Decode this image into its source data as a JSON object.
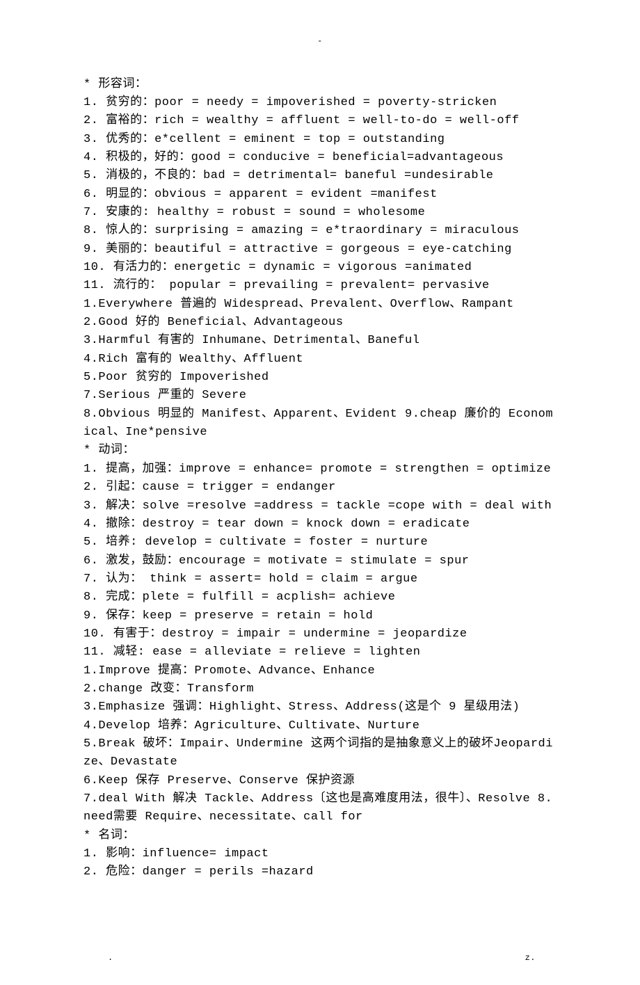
{
  "topMark": "-",
  "footerLeft": ".",
  "footerRight": "z.",
  "lines": [
    "* 形容词：",
    "1. 贫穷的：poor = needy = impoverished = poverty-stricken",
    "2. 富裕的：rich = wealthy = affluent = well-to-do = well-off",
    "3. 优秀的：e*cellent = eminent = top = outstanding",
    "4. 积极的，好的：good = conducive = beneficial=advantageous",
    "5. 消极的，不良的：bad = detrimental= baneful =undesirable",
    "6. 明显的：obvious = apparent = evident =manifest",
    "7. 安康的: healthy = robust = sound = wholesome",
    "8. 惊人的：surprising = amazing = e*traordinary = miraculous",
    "9. 美丽的：beautiful = attractive = gorgeous = eye-catching",
    "10. 有活力的：energetic = dynamic = vigorous =animated",
    "11. 流行的： popular = prevailing = prevalent= pervasive",
    "1.Everywhere 普遍的 Widespread、Prevalent、Overflow、Rampant",
    "2.Good 好的 Beneficial、Advantageous",
    "3.Harmful 有害的 Inhumane、Detrimental、Baneful",
    "4.Rich 富有的 Wealthy、Affluent",
    "5.Poor 贫穷的 Impoverished",
    "7.Serious 严重的 Severe",
    "8.Obvious 明显的 Manifest、Apparent、Evident 9.cheap 廉价的 Economical、Ine*pensive",
    "* 动词：",
    "1. 提高，加强：improve = enhance= promote = strengthen = optimize",
    "2. 引起：cause = trigger = endanger",
    "3. 解决：solve =resolve =address = tackle =cope with = deal with",
    "4. 撤除：destroy = tear down = knock down = eradicate",
    "5. 培养: develop = cultivate = foster = nurture",
    "6. 激发，鼓励：encourage = motivate = stimulate = spur",
    "7. 认为： think = assert= hold = claim = argue",
    "8. 完成：plete = fulfill = acplish= achieve",
    "9. 保存：keep = preserve = retain = hold",
    "10. 有害于：destroy = impair = undermine = jeopardize",
    "11. 减轻: ease = alleviate = relieve = lighten",
    "1.Improve 提高：Promote、Advance、Enhance",
    "2.change 改变：Transform",
    "3.Emphasize 强调：Highlight、Stress、Address(这是个 9 星级用法)",
    "4.Develop 培养：Agriculture、Cultivate、Nurture",
    "5.Break 破坏：Impair、Undermine 这两个词指的是抽象意义上的破坏Jeopardize、Devastate",
    "6.Keep 保存 Preserve、Conserve 保护资源",
    "7.deal With 解决 Tackle、Address〔这也是高难度用法，很牛〕、Resolve 8.need需要 Require、necessitate、call for",
    "* 名词：",
    "1. 影响：influence= impact",
    "2. 危险：danger = perils =hazard"
  ]
}
